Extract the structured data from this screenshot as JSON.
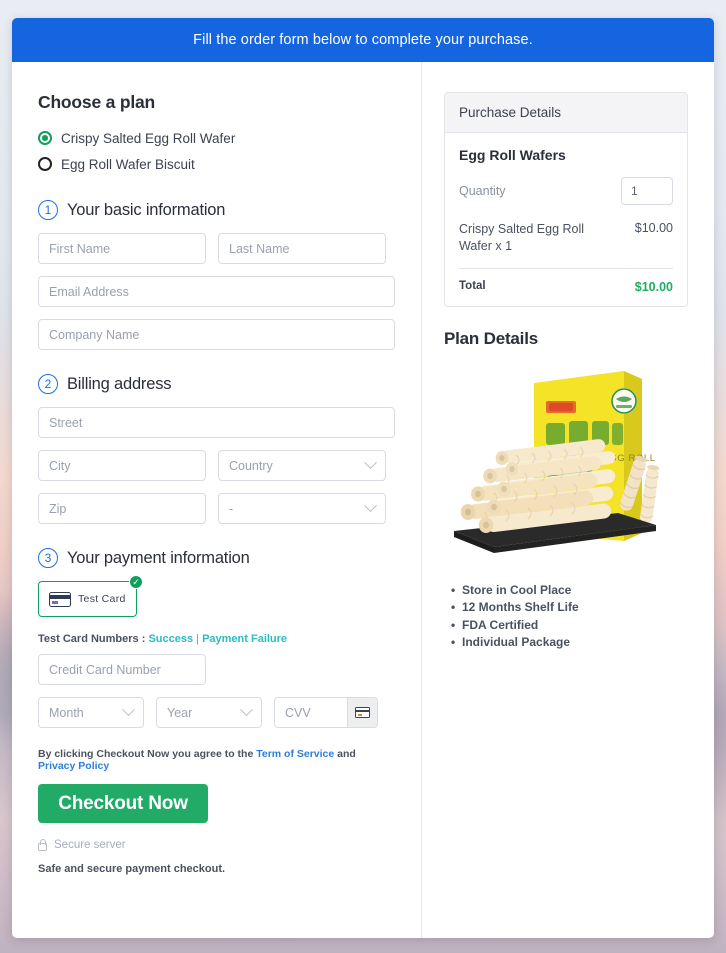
{
  "banner": {
    "text": "Fill the order form below to complete your purchase."
  },
  "plan": {
    "title": "Choose a plan",
    "options": [
      {
        "label": "Crispy Salted Egg Roll Wafer",
        "selected": true
      },
      {
        "label": "Egg Roll Wafer Biscuit",
        "selected": false
      }
    ]
  },
  "steps": {
    "basic": {
      "num": "1",
      "label": "Your basic information"
    },
    "billing": {
      "num": "2",
      "label": "Billing address"
    },
    "payment": {
      "num": "3",
      "label": "Your payment information"
    }
  },
  "fields": {
    "first_name": "First Name",
    "last_name": "Last Name",
    "email": "Email Address",
    "company": "Company Name",
    "street": "Street",
    "city": "City",
    "country": "Country",
    "zip": "Zip",
    "state": "-",
    "credit_card": "Credit Card Number",
    "month": "Month",
    "year": "Year",
    "cvv": "CVV"
  },
  "payment": {
    "tile_label": "Test  Card",
    "tile_check": "✓",
    "test_prefix": "Test Card Numbers : ",
    "link_success": "Success",
    "link_separator": " | ",
    "link_failure": "Payment Failure"
  },
  "footer": {
    "agree_prefix": "By clicking Checkout Now you agree to the ",
    "terms": "Term of Service",
    "agree_and": " and ",
    "privacy": "Privacy Policy",
    "checkout_label": "Checkout Now",
    "secure_server": "Secure server",
    "safe_text": "Safe and secure payment checkout."
  },
  "purchase": {
    "header": "Purchase Details",
    "product": "Egg Roll Wafers",
    "quantity_label": "Quantity",
    "quantity_value": "1",
    "line_desc": "Crispy Salted Egg Roll Wafer x 1",
    "line_amount": "$10.00",
    "total_label": "Total",
    "total_amount": "$10.00"
  },
  "plan_details": {
    "title": "Plan Details",
    "image_alt": "coconut-egg-roll-product-photo",
    "package_text": "COCONUT EGG ROLL",
    "features": [
      "Store in Cool Place",
      "12 Months Shelf Life",
      "FDA Certified",
      "Individual Package"
    ]
  },
  "colors": {
    "banner_blue": "#1565e0",
    "accent_green": "#22ab66",
    "radio_green": "#12a05c",
    "link_teal": "#2bbbc4",
    "link_blue": "#2b7ede",
    "step_blue": "#1e6fe0"
  }
}
